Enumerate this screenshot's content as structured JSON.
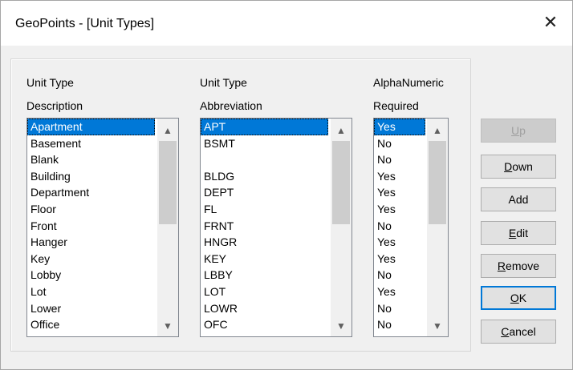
{
  "window": {
    "title": "GeoPoints - [Unit Types]",
    "close_glyph": "✕"
  },
  "headers": {
    "description": [
      "Unit Type",
      "Description"
    ],
    "abbreviation": [
      "Unit Type",
      "Abbreviation"
    ],
    "alphanumeric": [
      "AlphaNumeric",
      "Required"
    ]
  },
  "lists": {
    "descriptions": [
      "Apartment",
      "Basement",
      "Blank",
      "Building",
      "Department",
      "Floor",
      "Front",
      "Hanger",
      "Key",
      "Lobby",
      "Lot",
      "Lower",
      "Office"
    ],
    "abbreviations": [
      "APT",
      "BSMT",
      "",
      "BLDG",
      "DEPT",
      "FL",
      "FRNT",
      "HNGR",
      "KEY",
      "LBBY",
      "LOT",
      "LOWR",
      "OFC"
    ],
    "required": [
      "Yes",
      "No",
      "No",
      "Yes",
      "Yes",
      "Yes",
      "No",
      "Yes",
      "Yes",
      "No",
      "Yes",
      "No",
      "No"
    ],
    "selected_index": 0
  },
  "buttons": {
    "up": {
      "pre": "",
      "acc": "U",
      "post": "p"
    },
    "down": {
      "pre": "",
      "acc": "D",
      "post": "own"
    },
    "add": {
      "pre": "Add",
      "acc": "",
      "post": ""
    },
    "edit": {
      "pre": "",
      "acc": "E",
      "post": "dit"
    },
    "remove": {
      "pre": "",
      "acc": "R",
      "post": "emove"
    },
    "ok": {
      "pre": "",
      "acc": "O",
      "post": "K"
    },
    "cancel": {
      "pre": "",
      "acc": "C",
      "post": "ancel"
    }
  },
  "scroll_arrows": {
    "up": "▲",
    "down": "▼"
  }
}
